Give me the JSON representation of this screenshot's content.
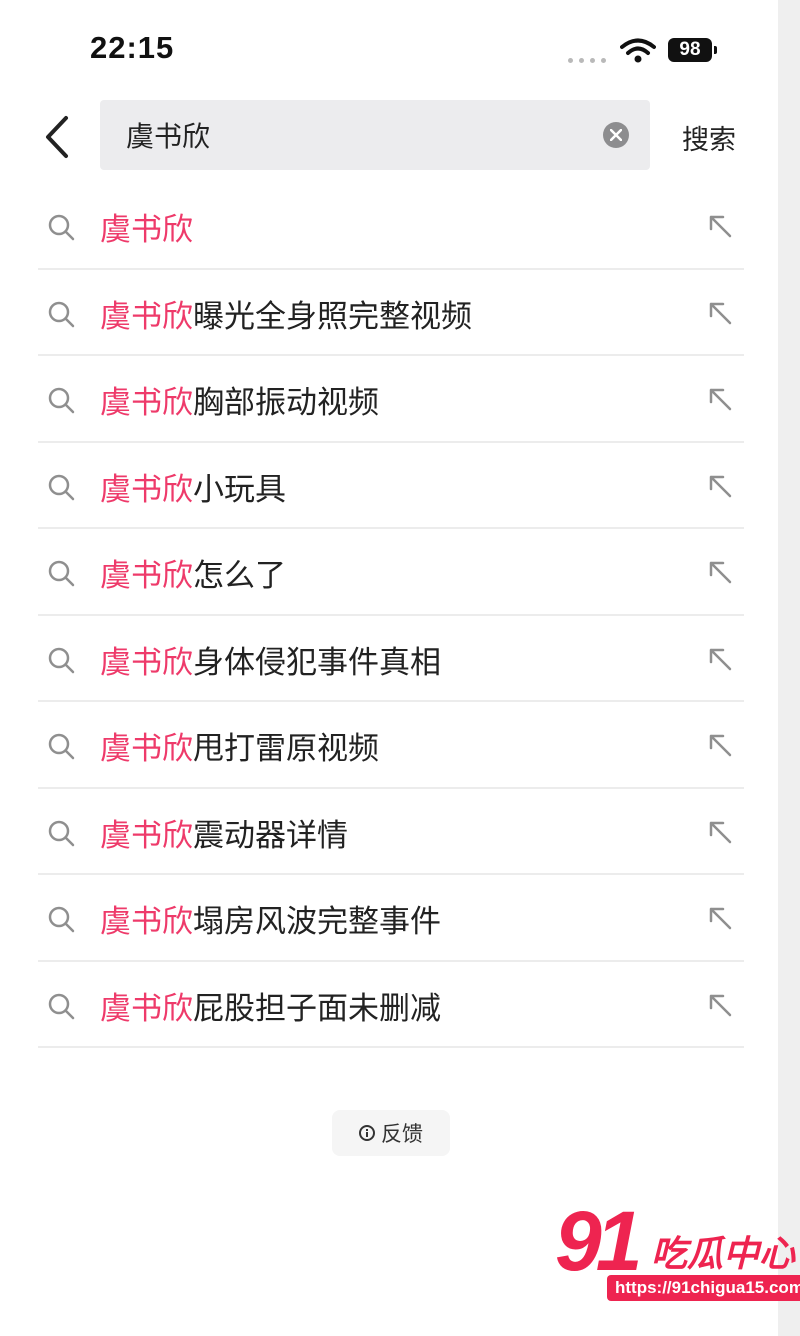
{
  "status_bar": {
    "time": "22:15",
    "battery": "98"
  },
  "search": {
    "query": "虞书欣",
    "submit_label": "搜索"
  },
  "suggestions": [
    {
      "keyword": "虞书欣",
      "suffix": ""
    },
    {
      "keyword": "虞书欣",
      "suffix": "曝光全身照完整视频"
    },
    {
      "keyword": "虞书欣",
      "suffix": "胸部振动视频"
    },
    {
      "keyword": "虞书欣",
      "suffix": "小玩具"
    },
    {
      "keyword": "虞书欣",
      "suffix": "怎么了"
    },
    {
      "keyword": "虞书欣",
      "suffix": "身体侵犯事件真相"
    },
    {
      "keyword": "虞书欣",
      "suffix": "甩打雷原视频"
    },
    {
      "keyword": "虞书欣",
      "suffix": "震动器详情"
    },
    {
      "keyword": "虞书欣",
      "suffix": "塌房风波完整事件"
    },
    {
      "keyword": "虞书欣",
      "suffix": "屁股担子面未删减"
    }
  ],
  "feedback": {
    "label": "反馈"
  },
  "watermark": {
    "number": "91",
    "title": "吃瓜中心",
    "url": "https://91chigua15.com"
  },
  "colors": {
    "keyword_highlight": "#ee3a6a",
    "watermark": "#ee2450"
  },
  "icons": {
    "back": "chevron-left-icon",
    "clear": "clear-circle-icon",
    "suggestion": "search-icon",
    "fill": "arrow-up-left-icon",
    "feedback": "info-icon",
    "wifi": "wifi-icon",
    "battery": "battery-icon"
  }
}
